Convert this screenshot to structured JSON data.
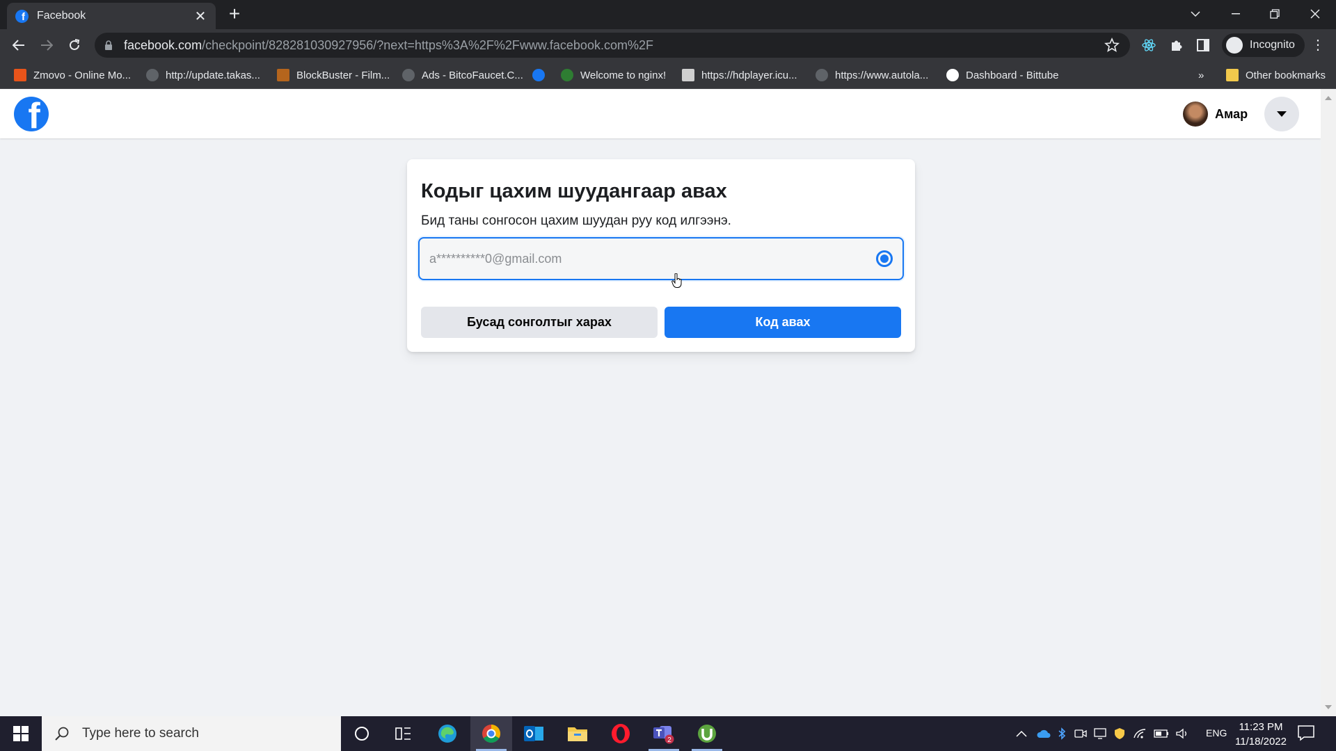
{
  "browser": {
    "tab_title": "Facebook",
    "tab_close": "✕",
    "new_tab": "+",
    "url_host": "facebook.com",
    "url_path": "/checkpoint/828281030927956/?next=https%3A%2F%2Fwww.facebook.com%2F",
    "profile_label": "Incognito",
    "overflow": "»",
    "bookmarks": [
      {
        "label": "Zmovo - Online Mo...",
        "color": "#e8541a"
      },
      {
        "label": "http://update.takas...",
        "color": "#9aa0a6"
      },
      {
        "label": "BlockBuster - Film...",
        "color": "#b5651d"
      },
      {
        "label": "Ads - BitcoFaucet.C...",
        "color": "#9aa0a6"
      },
      {
        "label": "",
        "color": "#1877f2"
      },
      {
        "label": "Welcome to nginx!",
        "color": "#2e7d32"
      },
      {
        "label": "https://hdplayer.icu...",
        "color": "#cfcfcf"
      },
      {
        "label": "https://www.autola...",
        "color": "#9aa0a6"
      },
      {
        "label": "Dashboard - Bittube",
        "color": "#ffffff"
      }
    ],
    "other_bookmarks": "Other bookmarks"
  },
  "facebook": {
    "profile_name": "Амар",
    "card": {
      "title": "Кодыг цахим шуудангаар авах",
      "description": "Бид таны сонгосон цахим шуудан руу код илгээнэ.",
      "email": "a**********0@gmail.com",
      "secondary_button": "Бусад сонголтыг харах",
      "primary_button": "Код авах"
    },
    "colors": {
      "brand": "#1877f2",
      "background": "#f0f2f5"
    }
  },
  "taskbar": {
    "search_placeholder": "Type here to search",
    "language": "ENG",
    "time": "11:23 PM",
    "date": "11/18/2022",
    "teams_badge": "2"
  }
}
